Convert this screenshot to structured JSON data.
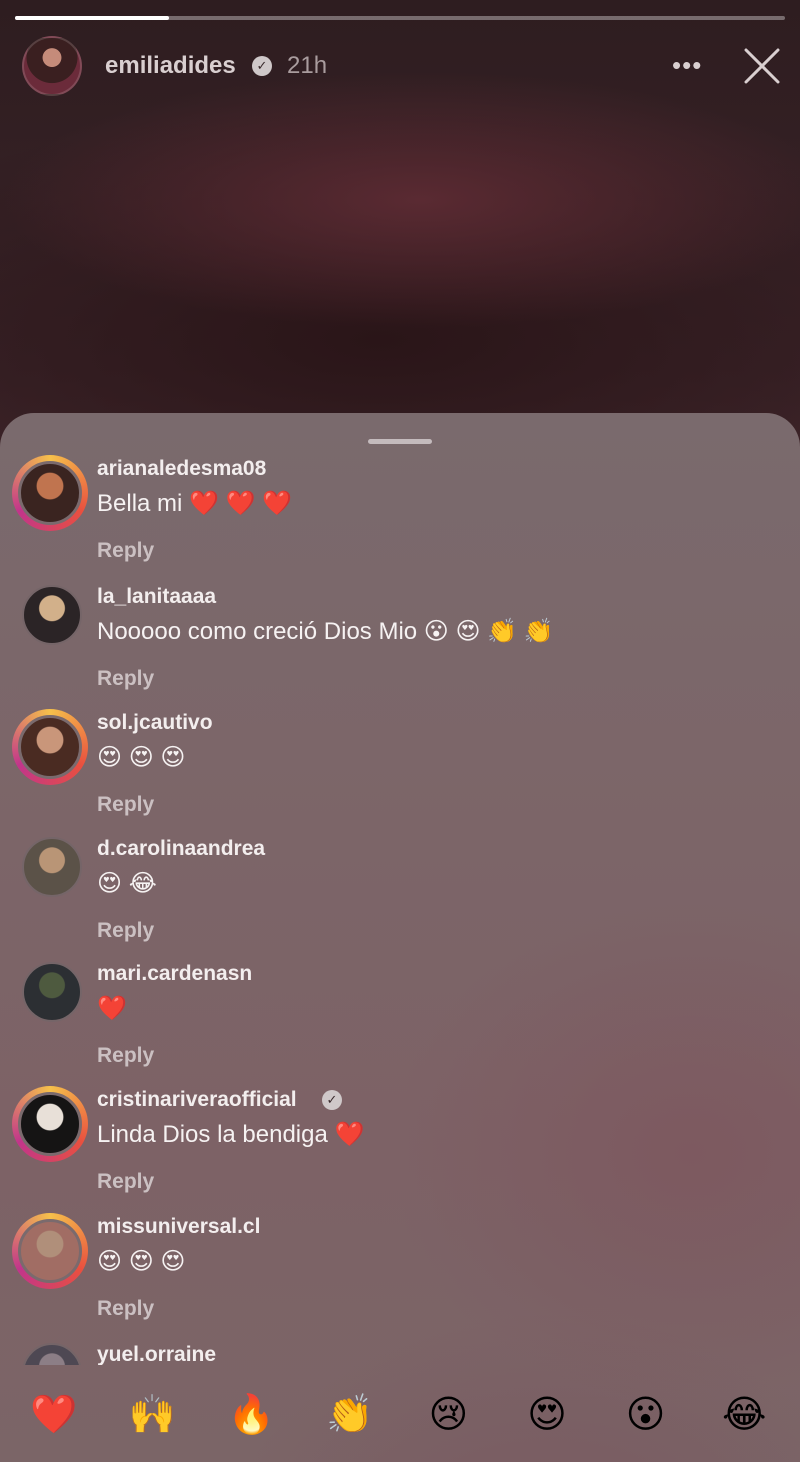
{
  "story": {
    "progress": 0.2,
    "username": "emiliadides",
    "verified": true,
    "time": "21h",
    "more_icon": "more-horizontal-icon",
    "close_icon": "close-icon"
  },
  "comments": [
    {
      "username": "arianaledesma08",
      "text": "Bella mi ❤️ ❤️ ❤️",
      "reply": "Reply",
      "story_ring": true,
      "avatar_colors": [
        "#c0744f",
        "#3a2420"
      ]
    },
    {
      "username": "la_lanitaaaa",
      "text": "Nooooo como creció Dios Mio 😮 😍 👏 👏",
      "reply": "Reply",
      "story_ring": false,
      "avatar_colors": [
        "#d2b08a",
        "#2b2426"
      ]
    },
    {
      "username": "sol.jcautivo",
      "text": "😍 😍 😍",
      "reply": "Reply",
      "story_ring": true,
      "avatar_colors": [
        "#c9967a",
        "#4a2b22"
      ]
    },
    {
      "username": "d.carolinaandrea",
      "text": "😍 😂",
      "reply": "Reply",
      "story_ring": false,
      "avatar_colors": [
        "#b99576",
        "#5b5248"
      ]
    },
    {
      "username": "mari.cardenasn",
      "text": "❤️",
      "reply": "Reply",
      "story_ring": false,
      "avatar_colors": [
        "#4e5a3f",
        "#2c2f33"
      ]
    },
    {
      "username": "cristinariveraofficial",
      "text": "Linda Dios la bendiga ❤️",
      "reply": "Reply",
      "story_ring": true,
      "verified": true,
      "avatar_colors": [
        "#e8e0d8",
        "#151414"
      ]
    },
    {
      "username": "missuniversal.cl",
      "text": "😍 😍 😍",
      "reply": "Reply",
      "story_ring": true,
      "avatar_colors": [
        "#b08f7a",
        "#a16d64"
      ]
    },
    {
      "username": "yuel.orraine",
      "text": "❤️ ❤️",
      "reply": "",
      "story_ring": false,
      "avatar_colors": [
        "#8c7e86",
        "#4e4853"
      ]
    }
  ],
  "reactions": [
    "❤️",
    "🙌",
    "🔥",
    "👏",
    "😢",
    "😍",
    "😮",
    "😂"
  ]
}
